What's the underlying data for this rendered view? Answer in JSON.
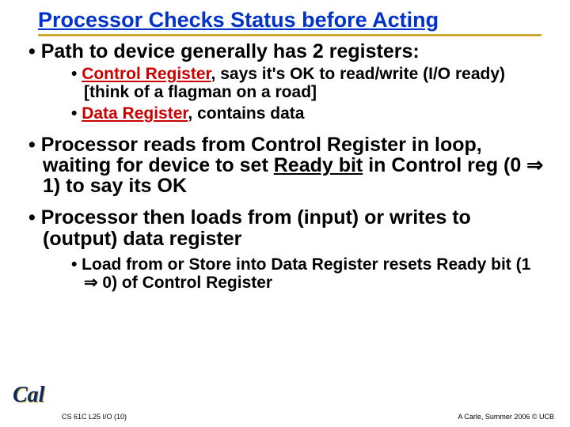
{
  "title": "Processor Checks Status before Acting",
  "bullets": {
    "b1_1_pre": "• Path to device generally has 2 registers:",
    "b2_1_term": "Control Register",
    "b2_1_rest": ", says it's OK to read/write (I/O ready) [think of a flagman on a road]",
    "b2_2_term": "Data Register",
    "b2_2_rest": ", contains data",
    "b1_2_pre": "• Processor reads from Control Register in loop, waiting for device to set ",
    "b1_2_term": "Ready bit",
    "b1_2_rest": " in Control reg (0 ⇒ 1) to say its OK",
    "b1_3": "• Processor then loads from (input) or writes to (output) data register",
    "b2_3": "• Load from or Store into Data Register resets Ready bit (1 ⇒  0) of Control Register"
  },
  "footer": {
    "left": "CS 61C L25 I/O (10)",
    "right": "A Carle, Summer 2006 © UCB"
  },
  "logo": {
    "text": "Cal"
  }
}
